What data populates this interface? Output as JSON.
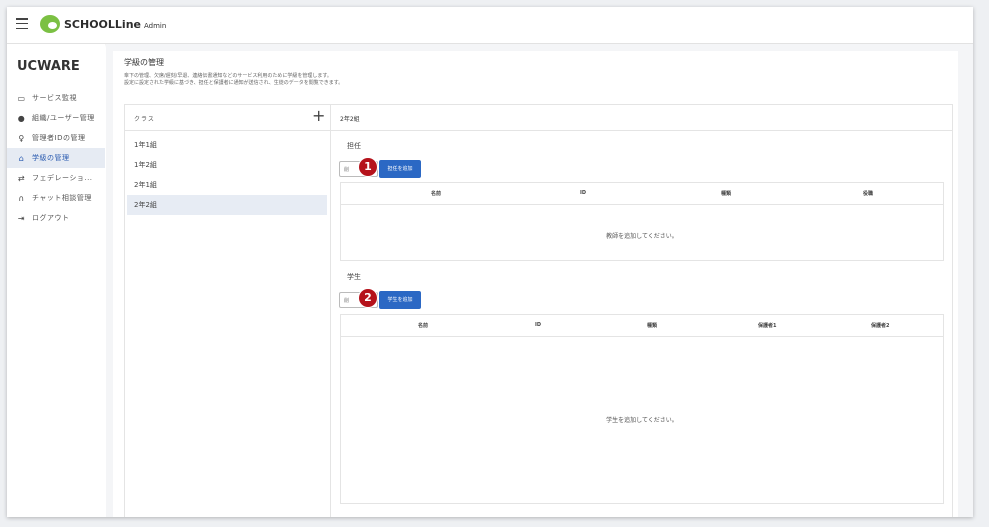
{
  "header": {
    "app_name": "SCHOOLLine",
    "app_suffix": "Admin"
  },
  "sidebar": {
    "brand": "UCWARE",
    "items": [
      {
        "label": "サービス監視",
        "icon": "monitor-icon",
        "glyph": "▭"
      },
      {
        "label": "組織/ユーザー管理",
        "icon": "user-circle-icon",
        "glyph": "●"
      },
      {
        "label": "管理者IDの管理",
        "icon": "person-pin-icon",
        "glyph": "♀"
      },
      {
        "label": "学級の管理",
        "icon": "home-icon",
        "glyph": "⌂",
        "active": true
      },
      {
        "label": "フェデレーショ...",
        "icon": "swap-icon",
        "glyph": "⇄"
      },
      {
        "label": "チャット相談管理",
        "icon": "support-icon",
        "glyph": "∩"
      },
      {
        "label": "ログアウト",
        "icon": "logout-icon",
        "glyph": "⇥"
      }
    ]
  },
  "page": {
    "title": "学級の管理",
    "desc_line1": "傘下の管理、欠席/遅刻/早退、連絡伝書通知などのサービス利用のために学級を管理します。",
    "desc_line2": "設定に設定された学級に基づき、担任と保護者に通知が送信され、生徒のデータを閲覧できます。"
  },
  "classes": {
    "header_label": "クラス",
    "add_symbol": "+",
    "items": [
      "1年1組",
      "1年2組",
      "2年1組",
      "2年2組"
    ],
    "selected": "2年2組"
  },
  "detail": {
    "title": "2年2組",
    "teacher_section": {
      "label": "担任",
      "small_box_text": "削",
      "badge": "1",
      "add_button": "担任を追加",
      "columns": [
        "名前",
        "ID",
        "種類",
        "役職"
      ],
      "empty_message": "教師を追加してください。"
    },
    "student_section": {
      "label": "学生",
      "small_box_text": "削",
      "badge": "2",
      "add_button": "学生を追加",
      "columns": [
        "名前",
        "ID",
        "種類",
        "保護者1",
        "保護者2"
      ],
      "empty_message": "学生を追加してください。"
    }
  },
  "colors": {
    "accent": "#2b68c4",
    "badge": "#b5121b",
    "active_bg": "#e6ebf3",
    "logo_green": "#7bc043"
  }
}
